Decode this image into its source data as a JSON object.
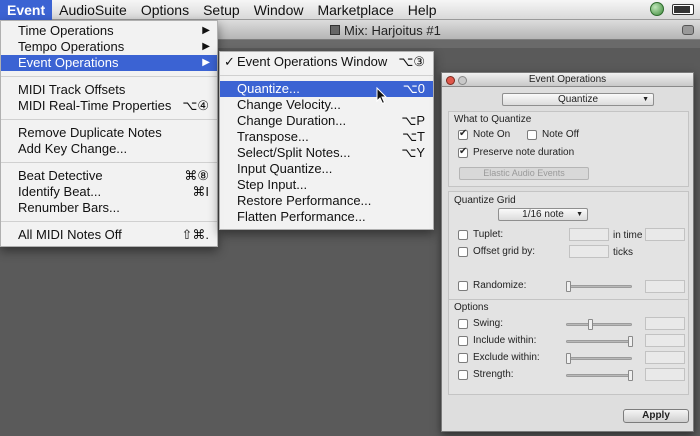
{
  "menubar": {
    "items": [
      "Event",
      "AudioSuite",
      "Options",
      "Setup",
      "Window",
      "Marketplace",
      "Help"
    ],
    "active": "Event"
  },
  "mix_window": {
    "title": "Mix: Harjoitus #1"
  },
  "event_menu": {
    "items": [
      {
        "label": "Time Operations",
        "submenu": true
      },
      {
        "label": "Tempo Operations",
        "submenu": true
      },
      {
        "label": "Event Operations",
        "submenu": true,
        "highlighted": true
      },
      {
        "separator": true
      },
      {
        "label": "MIDI Track Offsets",
        "shortcut": ""
      },
      {
        "label": "MIDI Real-Time Properties",
        "shortcut": "⌥④"
      },
      {
        "separator": true
      },
      {
        "label": "Remove Duplicate Notes",
        "shortcut": ""
      },
      {
        "label": "Add Key Change...",
        "shortcut": ""
      },
      {
        "separator": true
      },
      {
        "label": "Beat Detective",
        "shortcut": "⌘⑧"
      },
      {
        "label": "Identify Beat...",
        "shortcut": "⌘I"
      },
      {
        "label": "Renumber Bars...",
        "shortcut": ""
      },
      {
        "separator": true
      },
      {
        "label": "All MIDI Notes Off",
        "shortcut": "⇧⌘."
      }
    ]
  },
  "event_ops_submenu": {
    "items": [
      {
        "label": "Event Operations Window",
        "shortcut": "⌥③",
        "checked": true
      },
      {
        "separator": true
      },
      {
        "label": "Quantize...",
        "shortcut": "⌥0",
        "highlighted": true
      },
      {
        "label": "Change Velocity...",
        "shortcut": ""
      },
      {
        "label": "Change Duration...",
        "shortcut": "⌥P"
      },
      {
        "label": "Transpose...",
        "shortcut": "⌥T"
      },
      {
        "label": "Select/Split Notes...",
        "shortcut": "⌥Y"
      },
      {
        "label": "Input Quantize...",
        "shortcut": ""
      },
      {
        "label": "Step Input...",
        "shortcut": ""
      },
      {
        "label": "Restore Performance...",
        "shortcut": ""
      },
      {
        "label": "Flatten Performance...",
        "shortcut": ""
      }
    ]
  },
  "panel": {
    "title": "Event Operations",
    "operation": "Quantize",
    "what_to_quantize": {
      "label": "What to Quantize",
      "note_on": {
        "label": "Note On",
        "checked": true
      },
      "note_off": {
        "label": "Note Off",
        "checked": false
      },
      "preserve": {
        "label": "Preserve note duration",
        "checked": true
      },
      "elastic_button": "Elastic Audio Events"
    },
    "grid": {
      "label": "Quantize Grid",
      "value": "1/16 note",
      "tuplet": {
        "label": "Tuplet:",
        "checked": false,
        "suffix": "in time"
      },
      "offset": {
        "label": "Offset grid by:",
        "checked": false,
        "suffix": "ticks"
      },
      "randomize": {
        "label": "Randomize:",
        "checked": false
      }
    },
    "options": {
      "label": "Options",
      "swing": {
        "label": "Swing:",
        "checked": false
      },
      "include": {
        "label": "Include within:",
        "checked": false
      },
      "exclude": {
        "label": "Exclude within:",
        "checked": false
      },
      "strength": {
        "label": "Strength:",
        "checked": false
      }
    },
    "apply": "Apply"
  },
  "icons": {
    "submenu_arrow": "▶",
    "checkmark": "✓",
    "dropdown": "▼"
  }
}
